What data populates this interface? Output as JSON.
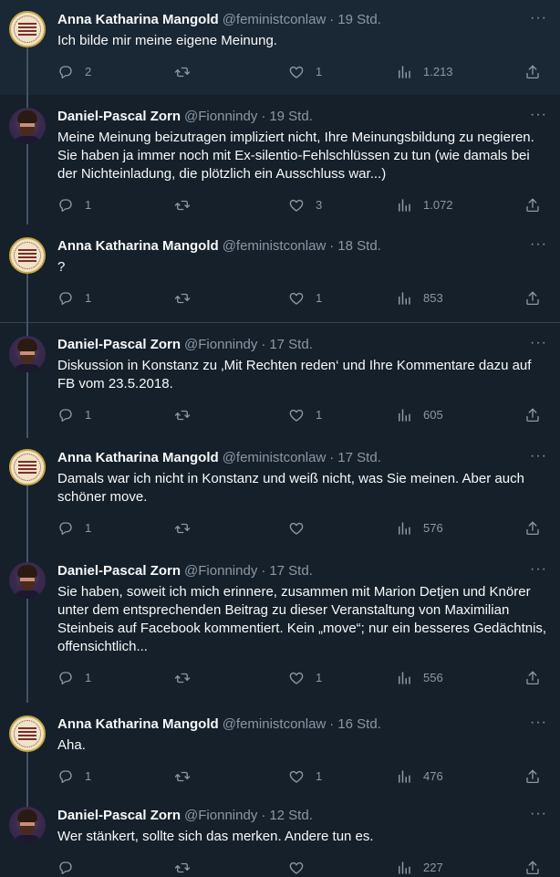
{
  "tweets": [
    {
      "author": "Anna Katharina Mangold",
      "handle": "@feministconlaw",
      "time": "19 Std.",
      "text": "Ich bilde mir meine eigene Meinung.",
      "replies": "2",
      "retweets": "",
      "likes": "1",
      "views": "1.213",
      "avatar": "anna"
    },
    {
      "author": "Daniel-Pascal Zorn",
      "handle": "@Fionnindy",
      "time": "19 Std.",
      "text": "Meine Meinung beizutragen impliziert nicht, Ihre Meinungsbildung zu negieren. Sie haben ja immer noch mit Ex-silentio-Fehlschlüssen zu tun (wie damals bei der Nichteinladung, die plötzlich ein Ausschluss war...)",
      "replies": "1",
      "retweets": "",
      "likes": "3",
      "views": "1.072",
      "avatar": "dan"
    },
    {
      "author": "Anna Katharina Mangold",
      "handle": "@feministconlaw",
      "time": "18 Std.",
      "text": "?",
      "replies": "1",
      "retweets": "",
      "likes": "1",
      "views": "853",
      "avatar": "anna"
    },
    {
      "author": "Daniel-Pascal Zorn",
      "handle": "@Fionnindy",
      "time": "17 Std.",
      "text": "Diskussion in Konstanz zu ‚Mit Rechten reden‘ und Ihre Kommentare dazu auf FB vom 23.5.2018.",
      "replies": "1",
      "retweets": "",
      "likes": "1",
      "views": "605",
      "avatar": "dan"
    },
    {
      "author": "Anna Katharina Mangold",
      "handle": "@feministconlaw",
      "time": "17 Std.",
      "text": "Damals war ich nicht in Konstanz und weiß nicht, was Sie meinen. Aber auch schöner move.",
      "replies": "1",
      "retweets": "",
      "likes": "",
      "views": "576",
      "avatar": "anna"
    },
    {
      "author": "Daniel-Pascal Zorn",
      "handle": "@Fionnindy",
      "time": "17 Std.",
      "text": "Sie haben, soweit ich mich erinnere, zusammen mit Marion Detjen und Knörer unter dem entsprechenden Beitrag zu dieser Veranstaltung von Maximilian Steinbeis auf Facebook kommentiert. Kein „move“; nur ein besseres Gedächtnis, offensichtlich...",
      "replies": "1",
      "retweets": "",
      "likes": "1",
      "views": "556",
      "avatar": "dan"
    },
    {
      "author": "Anna Katharina Mangold",
      "handle": "@feministconlaw",
      "time": "16 Std.",
      "text": "Aha.",
      "replies": "1",
      "retweets": "",
      "likes": "1",
      "views": "476",
      "avatar": "anna"
    },
    {
      "author": "Daniel-Pascal Zorn",
      "handle": "@Fionnindy",
      "time": "12 Std.",
      "text": "Wer stänkert, sollte sich das merken. Andere tun es.",
      "replies": "",
      "retweets": "",
      "likes": "",
      "views": "227",
      "avatar": "dan"
    }
  ],
  "colors": {
    "background": "#15202b",
    "focus_background": "#1a2734",
    "text": "#f7f9f9",
    "muted": "#8b98a5",
    "thread_line": "#425364"
  },
  "icons": [
    "reply-icon",
    "retweet-icon",
    "like-icon",
    "views-icon",
    "share-icon",
    "more-icon"
  ]
}
